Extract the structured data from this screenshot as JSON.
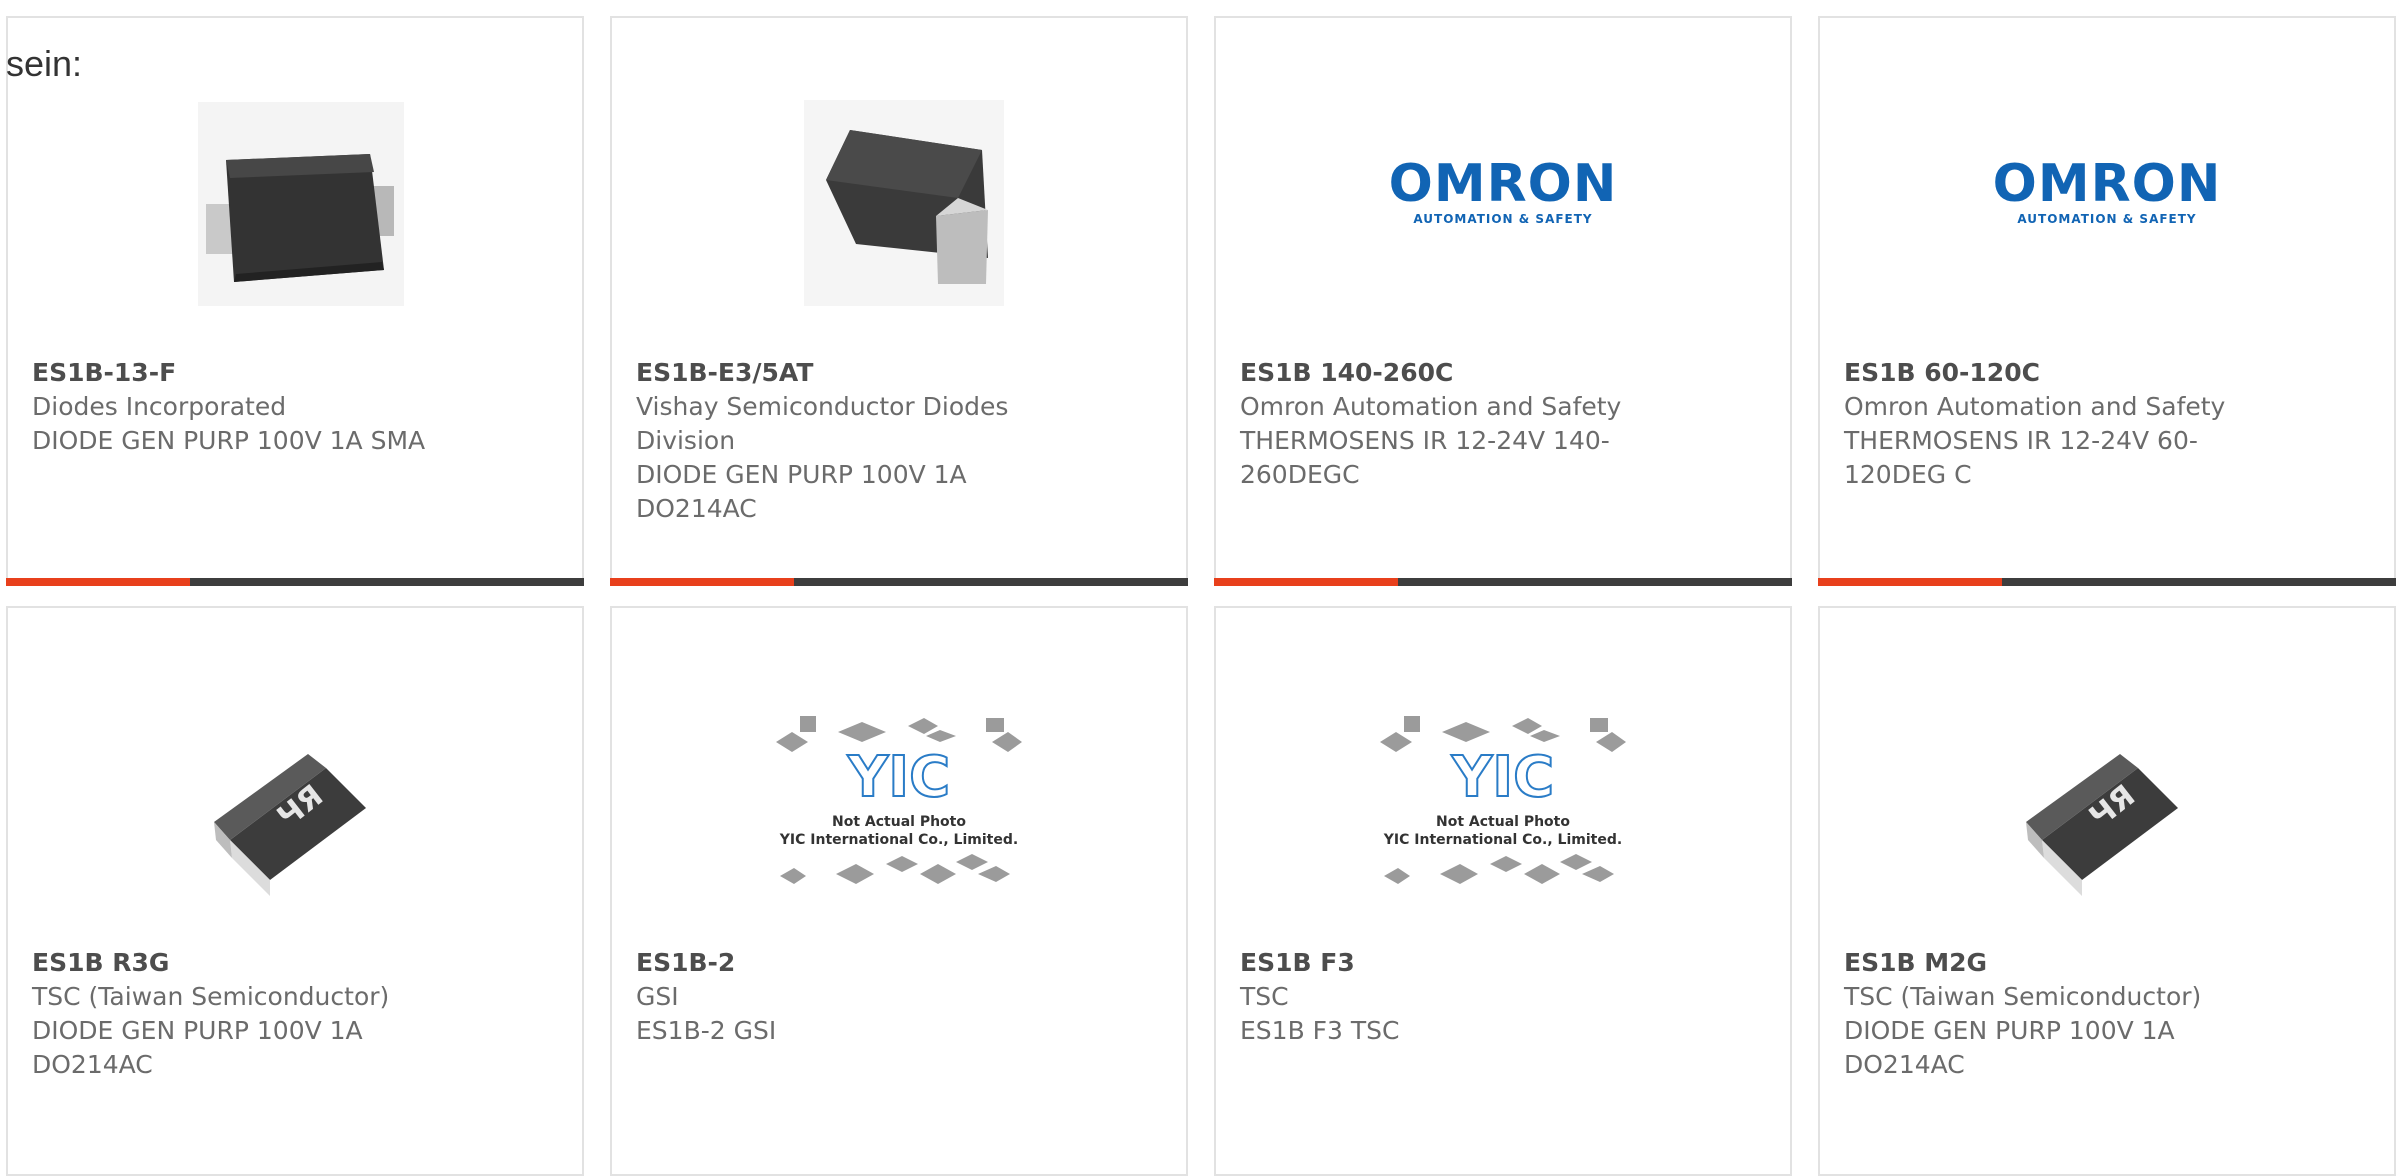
{
  "intro": "sein:",
  "accent_color": "#e8401c",
  "bar_color": "#3d3d3d",
  "products": [
    {
      "part": "ES1B-13-F",
      "maker": "Diodes Incorporated",
      "desc": "DIODE GEN PURP 100V 1A SMA",
      "image": "sma-diode-photo"
    },
    {
      "part": "ES1B-E3/5AT",
      "maker": "Vishay Semiconductor Diodes Division",
      "desc": "DIODE GEN PURP 100V 1A DO214AC",
      "image": "do214ac-diode-photo"
    },
    {
      "part": "ES1B 140-260C",
      "maker": "Omron Automation and Safety",
      "desc": "THERMOSENS IR 12-24V 140-260DEGC",
      "image": "omron-logo",
      "logo_text": "OMRON",
      "logo_sub": "AUTOMATION & SAFETY"
    },
    {
      "part": "ES1B 60-120C",
      "maker": "Omron Automation and Safety",
      "desc": "THERMOSENS IR 12-24V 60-120DEG C",
      "image": "omron-logo",
      "logo_text": "OMRON",
      "logo_sub": "AUTOMATION & SAFETY"
    },
    {
      "part": "ES1B R3G",
      "maker": "TSC (Taiwan Semiconductor)",
      "desc": "DIODE GEN PURP 100V 1A DO214AC",
      "image": "tsc-diode-photo"
    },
    {
      "part": "ES1B-2",
      "maker": "GSI",
      "desc": "ES1B-2 GSI",
      "image": "yic-placeholder",
      "ph_line1": "Not Actual Photo",
      "ph_line2": "YIC International Co., Limited.",
      "ph_logo": "YIC"
    },
    {
      "part": "ES1B F3",
      "maker": "TSC",
      "desc": "ES1B F3 TSC",
      "image": "yic-placeholder",
      "ph_line1": "Not Actual Photo",
      "ph_line2": "YIC International Co., Limited.",
      "ph_logo": "YIC"
    },
    {
      "part": "ES1B M2G",
      "maker": "TSC (Taiwan Semiconductor)",
      "desc": "DIODE GEN PURP 100V 1A DO214AC",
      "image": "tsc-diode-photo"
    }
  ]
}
